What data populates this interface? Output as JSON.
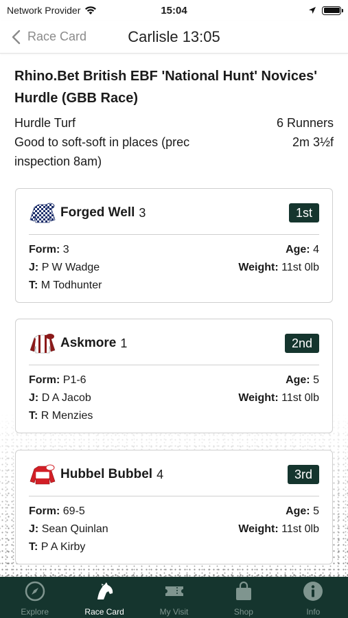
{
  "status_bar": {
    "carrier": "Network Provider",
    "time": "15:04"
  },
  "nav": {
    "back_label": "Race Card",
    "title": "Carlisle 13:05"
  },
  "race": {
    "title": "Rhino.Bet British EBF 'National Hunt' Novices' Hurdle (GBB Race)",
    "type": "Hurdle Turf",
    "runners": "6 Runners",
    "going": "Good to soft-soft in places (prec inspection 8am)",
    "distance": "2m 3½f"
  },
  "labels": {
    "form": "Form:",
    "jockey": "J:",
    "trainer": "T:",
    "age": "Age:",
    "weight": "Weight:"
  },
  "runners": [
    {
      "name": "Forged Well",
      "number": "3",
      "position": "1st",
      "form": "3",
      "jockey": "P W Wadge",
      "trainer": "M Todhunter",
      "age": "4",
      "weight": "11st 0lb",
      "silks_icon": "checkered-silks-icon"
    },
    {
      "name": "Askmore",
      "number": "1",
      "position": "2nd",
      "form": "P1-6",
      "jockey": "D A Jacob",
      "trainer": "R Menzies",
      "age": "5",
      "weight": "11st 0lb",
      "silks_icon": "maroon-white-silks-icon"
    },
    {
      "name": "Hubbel Bubbel",
      "number": "4",
      "position": "3rd",
      "form": "69-5",
      "jockey": "Sean Quinlan",
      "trainer": "P A Kirby",
      "age": "5",
      "weight": "11st 0lb",
      "silks_icon": "red-white-silks-icon"
    }
  ],
  "tabs": [
    {
      "label": "Explore",
      "icon": "compass-icon",
      "active": false
    },
    {
      "label": "Race Card",
      "icon": "horse-head-icon",
      "active": true
    },
    {
      "label": "My Visit",
      "icon": "ticket-icon",
      "active": false
    },
    {
      "label": "Shop",
      "icon": "shopping-bag-icon",
      "active": false
    },
    {
      "label": "Info",
      "icon": "info-icon",
      "active": false
    }
  ],
  "colors": {
    "brand_dark_green": "#15352e",
    "tab_inactive": "#7f958f",
    "back_grey": "#8a8a8a"
  }
}
